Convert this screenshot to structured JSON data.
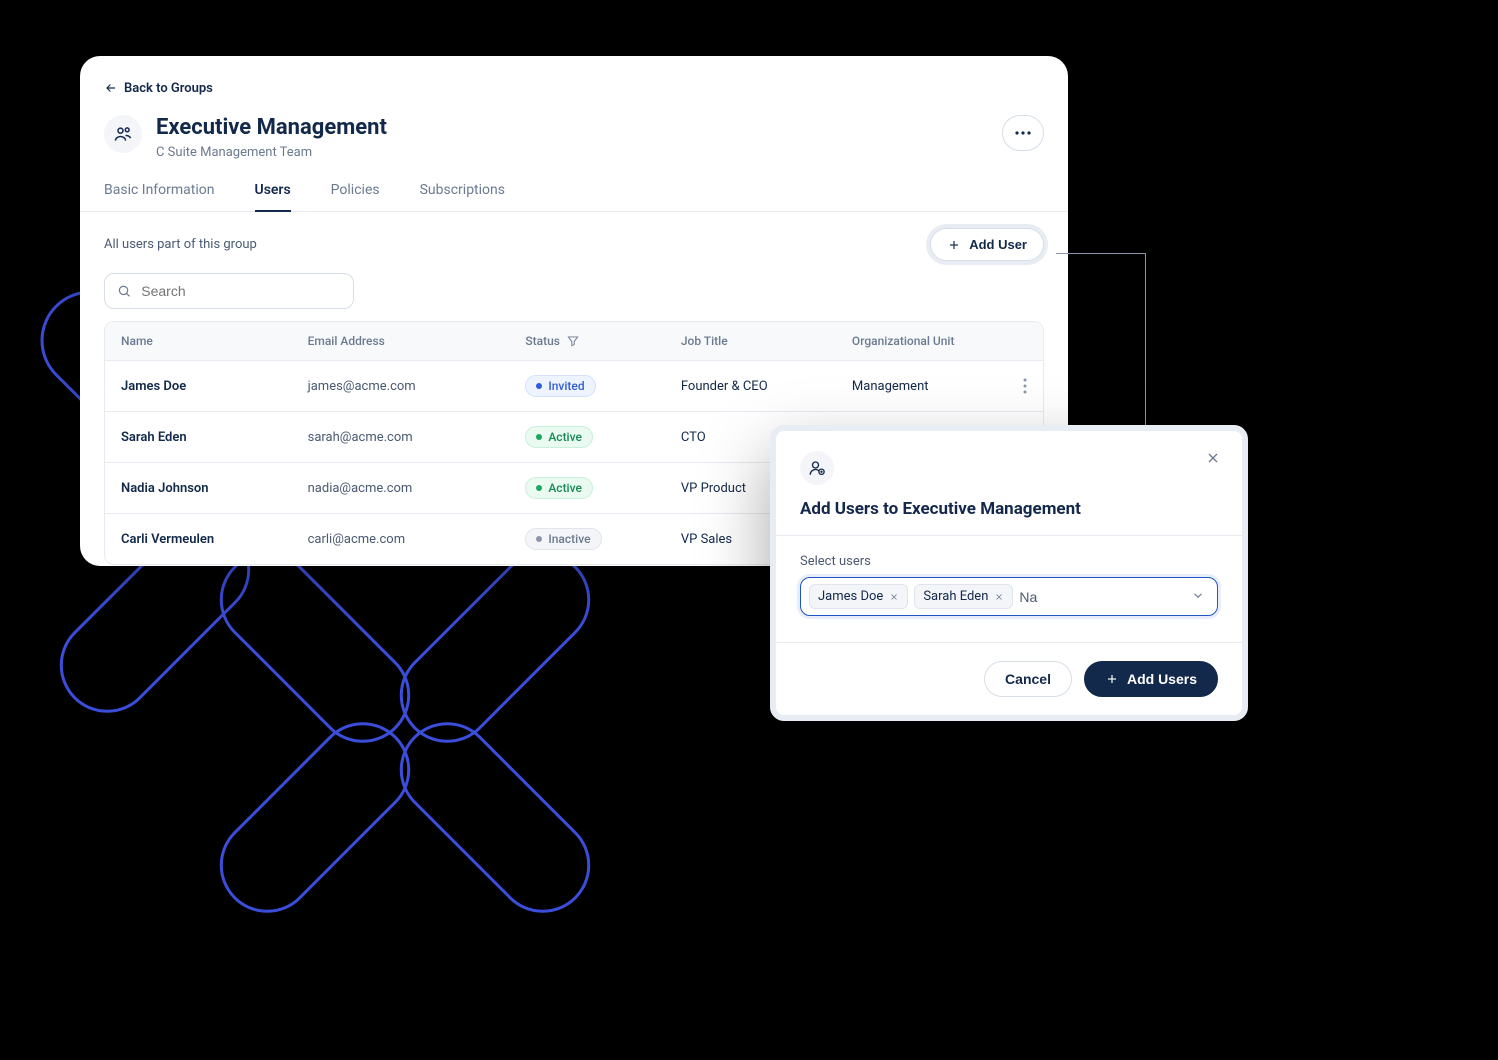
{
  "back_link": "Back to Groups",
  "group": {
    "title": "Executive Management",
    "subtitle": "C Suite Management Team"
  },
  "tabs": [
    "Basic Information",
    "Users",
    "Policies",
    "Subscriptions"
  ],
  "active_tab_index": 1,
  "subbar_text": "All users part of this group",
  "add_user_label": "Add User",
  "search_placeholder": "Search",
  "table": {
    "headers": [
      "Name",
      "Email Address",
      "Status",
      "Job Title",
      "Organizational Unit"
    ],
    "rows": [
      {
        "name": "James Doe",
        "email": "james@acme.com",
        "status": "Invited",
        "status_kind": "invited",
        "job_title": "Founder & CEO",
        "org_unit": "Management"
      },
      {
        "name": "Sarah Eden",
        "email": "sarah@acme.com",
        "status": "Active",
        "status_kind": "active",
        "job_title": "CTO",
        "org_unit": ""
      },
      {
        "name": "Nadia Johnson",
        "email": "nadia@acme.com",
        "status": "Active",
        "status_kind": "active",
        "job_title": "VP Product",
        "org_unit": ""
      },
      {
        "name": "Carli Vermeulen",
        "email": "carli@acme.com",
        "status": "Inactive",
        "status_kind": "inactive",
        "job_title": "VP Sales",
        "org_unit": ""
      }
    ]
  },
  "modal": {
    "title": "Add Users to Executive Management",
    "field_label": "Select users",
    "chips": [
      "James Doe",
      "Sarah Eden"
    ],
    "input_value": "Na",
    "cancel_label": "Cancel",
    "confirm_label": "Add Users"
  }
}
